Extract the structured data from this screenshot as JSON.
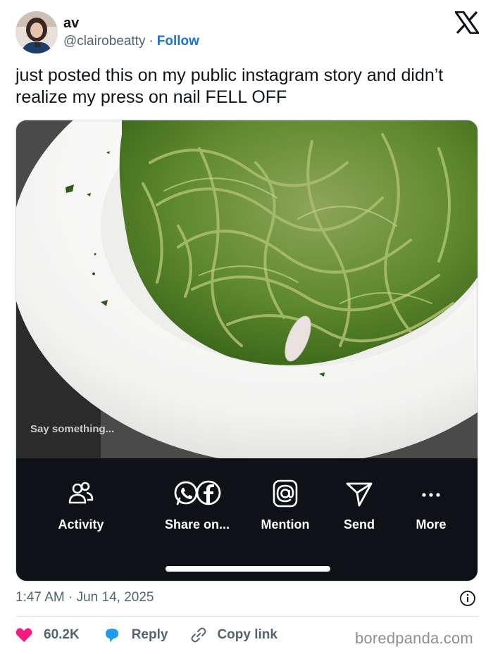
{
  "author": {
    "name": "av",
    "handle": "@clairobeatty",
    "separator": "·",
    "follow_label": "Follow"
  },
  "tweet": {
    "text": "just posted this on my public instagram story and didn’t realize my press on nail FELL OFF"
  },
  "media": {
    "story_input_placeholder": "Say something...",
    "share_actions": [
      {
        "label": "Activity",
        "icon": "activity-people-icon"
      },
      {
        "label": "Share on...",
        "icon": "whatsapp-facebook-icon"
      },
      {
        "label": "Mention",
        "icon": "at-mention-icon"
      },
      {
        "label": "Send",
        "icon": "send-paper-plane-icon"
      },
      {
        "label": "More",
        "icon": "more-dots-icon"
      }
    ]
  },
  "footer": {
    "timestamp": "1:47 AM · Jun 14, 2025",
    "like_count": "60.2K",
    "reply_label": "Reply",
    "copy_link_label": "Copy link",
    "watermark": "boredpanda.com"
  },
  "colors": {
    "like": "#f91880",
    "reply": "#1d9bf0",
    "follow": "#1d74cf",
    "text_primary": "#0f1419",
    "text_secondary": "#536471"
  }
}
